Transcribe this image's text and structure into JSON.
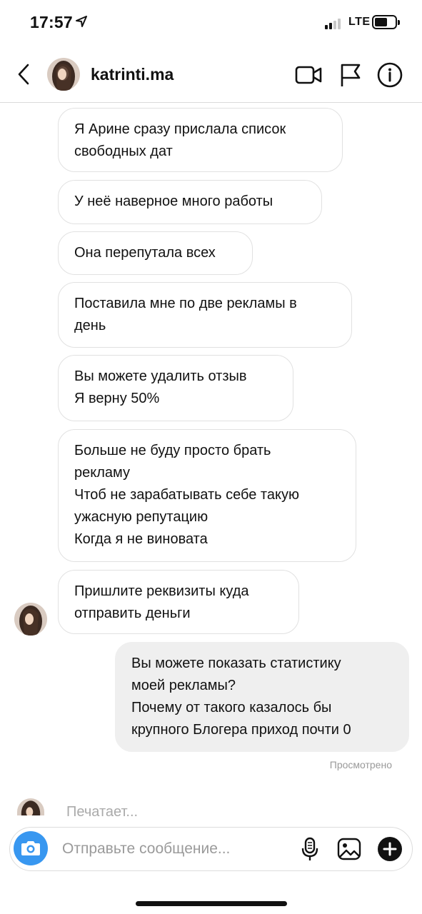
{
  "status_bar": {
    "time": "17:57",
    "network": "LTE"
  },
  "header": {
    "username": "katrinti.ma"
  },
  "messages": [
    {
      "sender": "them",
      "lines": [
        "Я Арине сразу прислала список",
        "свободных дат"
      ]
    },
    {
      "sender": "them",
      "lines": [
        "У неё наверное много работы"
      ]
    },
    {
      "sender": "them",
      "lines": [
        "Она перепутала всех"
      ]
    },
    {
      "sender": "them",
      "lines": [
        "Поставила мне по две рекламы в",
        "день"
      ]
    },
    {
      "sender": "them",
      "lines": [
        "Вы можете удалить отзыв",
        "Я верну 50%"
      ]
    },
    {
      "sender": "them",
      "lines": [
        "Больше не буду просто брать",
        "рекламу",
        "Чтоб не зарабатывать себе такую",
        "ужасную репутацию",
        "Когда я не виновата"
      ]
    },
    {
      "sender": "them",
      "lines": [
        "Пришлите реквизиты куда",
        "отправить деньги"
      ]
    },
    {
      "sender": "me",
      "lines": [
        "Вы можете показать статистику",
        "моей рекламы?",
        "Почему от такого казалось бы",
        "крупного Блогера приход почти 0"
      ]
    }
  ],
  "seen_label": "Просмотрено",
  "typing_label": "Печатает...",
  "composer": {
    "placeholder": "Отправьте сообщение..."
  },
  "colors": {
    "accent": "#3897f0",
    "my_bubble": "#efefef",
    "bubble_border": "#e1e1e1"
  },
  "icons": [
    "location-arrow-icon",
    "signal-icon",
    "battery-icon",
    "back-chevron-icon",
    "video-call-icon",
    "flag-icon",
    "info-icon",
    "camera-icon",
    "microphone-icon",
    "gallery-icon",
    "plus-icon"
  ]
}
